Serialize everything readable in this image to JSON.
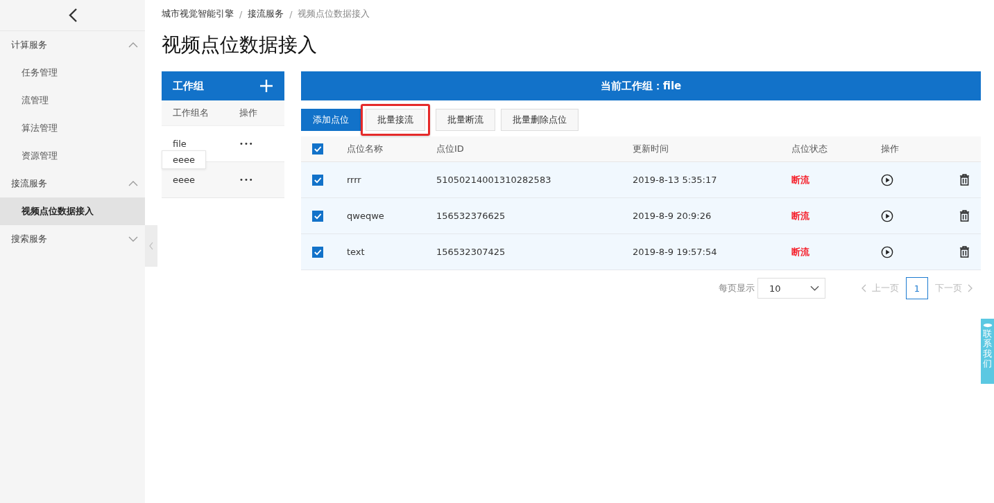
{
  "sidebar": {
    "sections": [
      {
        "label": "计算服务",
        "expanded": true,
        "items": [
          {
            "label": "任务管理",
            "selected": false
          },
          {
            "label": "流管理",
            "selected": false
          },
          {
            "label": "算法管理",
            "selected": false
          },
          {
            "label": "资源管理",
            "selected": false
          }
        ]
      },
      {
        "label": "接流服务",
        "expanded": true,
        "items": [
          {
            "label": "视频点位数据接入",
            "selected": true
          }
        ]
      },
      {
        "label": "搜索服务",
        "expanded": false
      }
    ]
  },
  "breadcrumb": {
    "separator": "/",
    "items": [
      "城市视觉智能引擎",
      "接流服务",
      "视频点位数据接入"
    ]
  },
  "page_title": "视频点位数据接入",
  "groups": {
    "title": "工作组",
    "columns": [
      "工作组名",
      "操作"
    ],
    "rows": [
      {
        "name": "file",
        "menu": "•••",
        "tooltip": "eeee"
      },
      {
        "name": "eeee",
        "menu": "•••"
      }
    ]
  },
  "points": {
    "title": "当前工作组：file",
    "toolbar": [
      {
        "label": "添加点位",
        "kind": "primary",
        "highlighted": false
      },
      {
        "label": "批量接流",
        "kind": "default",
        "highlighted": true
      },
      {
        "label": "批量断流",
        "kind": "default",
        "highlighted": false
      },
      {
        "label": "批量删除点位",
        "kind": "default",
        "highlighted": false
      }
    ],
    "all_checked": true,
    "columns": [
      "点位名称",
      "点位ID",
      "更新时间",
      "点位状态",
      "操作"
    ],
    "rows": [
      {
        "checked": true,
        "name": "rrrr",
        "id": "51050214001310282583",
        "time": "2019-8-13 5:35:17",
        "status": "断流"
      },
      {
        "checked": true,
        "name": "qweqwe",
        "id": "156532376625",
        "time": "2019-8-9 20:9:26",
        "status": "断流"
      },
      {
        "checked": true,
        "name": "text",
        "id": "156532307425",
        "time": "2019-8-9 19:57:54",
        "status": "断流"
      }
    ]
  },
  "pagination": {
    "page_size_label": "每页显示",
    "page_size": "10",
    "prev": "上一页",
    "pages": [
      {
        "label": "1",
        "selected": true
      }
    ],
    "next": "下一页"
  },
  "contact": "联系我们"
}
